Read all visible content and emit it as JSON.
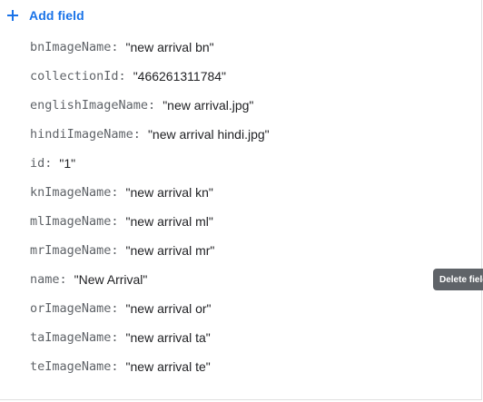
{
  "toolbar": {
    "add_field_label": "Add field",
    "add_field_icon": "plus-icon"
  },
  "colors": {
    "accent": "#1a73e8",
    "key_text": "#5f6368",
    "value_text": "#202124",
    "tooltip_bg": "#5f6368"
  },
  "fields": [
    {
      "key": "bnImageName",
      "value": "\"new arrival bn\""
    },
    {
      "key": "collectionId",
      "value": "\"466261311784\""
    },
    {
      "key": "englishImageName",
      "value": "\"new arrival.jpg\""
    },
    {
      "key": "hindiImageName",
      "value": "\"new arrival hindi.jpg\""
    },
    {
      "key": "id",
      "value": "\"1\""
    },
    {
      "key": "knImageName",
      "value": "\"new arrival kn\""
    },
    {
      "key": "mlImageName",
      "value": "\"new arrival ml\""
    },
    {
      "key": "mrImageName",
      "value": "\"new arrival mr\""
    },
    {
      "key": "name",
      "value": "\"New Arrival\""
    },
    {
      "key": "orImageName",
      "value": "\"new arrival or\""
    },
    {
      "key": "taImageName",
      "value": "\"new arrival ta\""
    },
    {
      "key": "teImageName",
      "value": "\"new arrival te\""
    }
  ],
  "separator": ":",
  "tooltip": {
    "text": "Delete field"
  }
}
